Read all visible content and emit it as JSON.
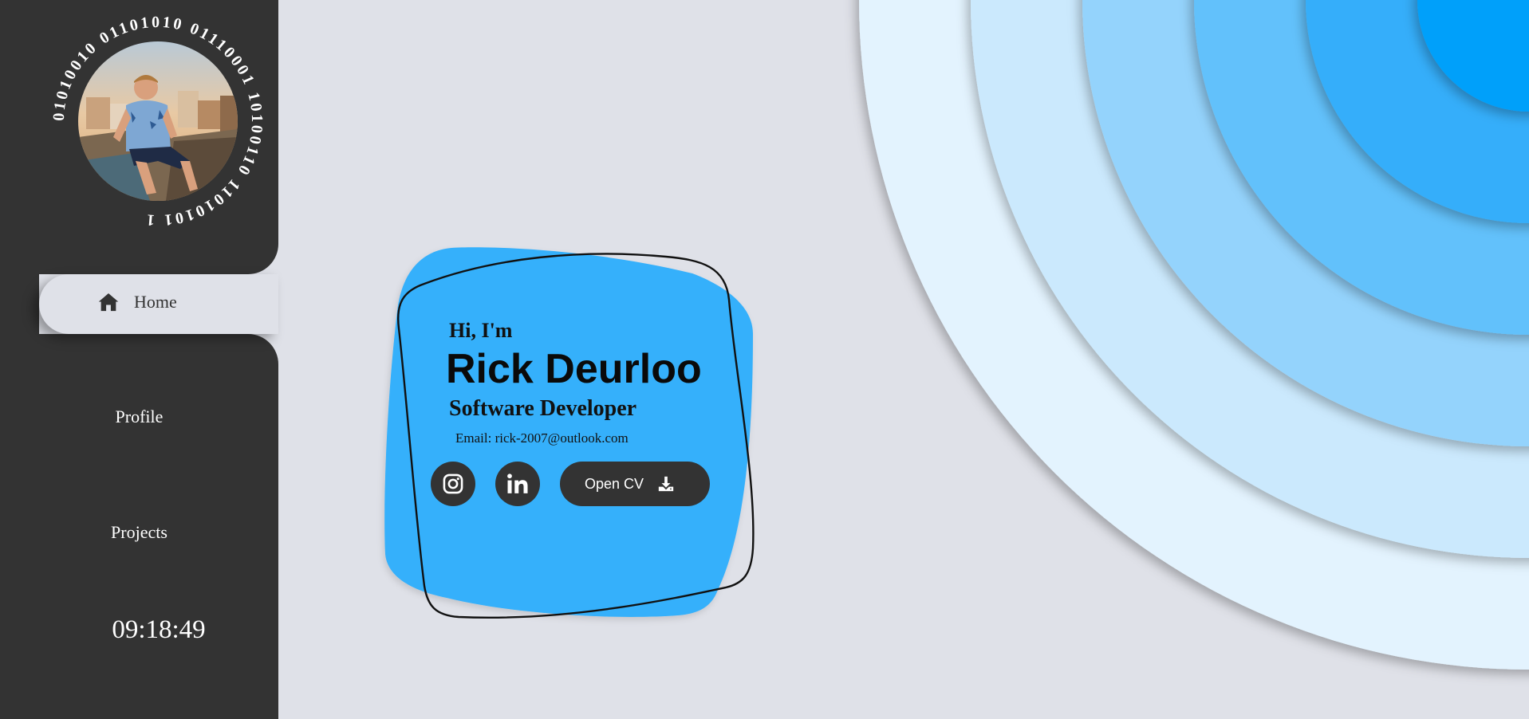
{
  "sidebar": {
    "avatar_ring_text": "01010010 01101010 01110001 10100110 11010101 1",
    "nav": {
      "home": "Home",
      "profile": "Profile",
      "projects": "Projects"
    },
    "clock": "09:18:49"
  },
  "hero": {
    "greeting": "Hi, I'm",
    "name": "Rick Deurloo",
    "role": "Software Developer",
    "email": "Email: rick-2007@outlook.com",
    "cv_button": "Open CV",
    "icons": [
      "home-icon",
      "instagram-icon",
      "linkedin-icon",
      "download-icon"
    ]
  },
  "colors": {
    "sidebar": "#333333",
    "background": "#dfe1e8",
    "card": "#35b0fb",
    "rings": [
      "#e3f3fe",
      "#cbe9fd",
      "#94d3fc",
      "#62c1fb",
      "#34aefa",
      "#00a0fa"
    ]
  }
}
